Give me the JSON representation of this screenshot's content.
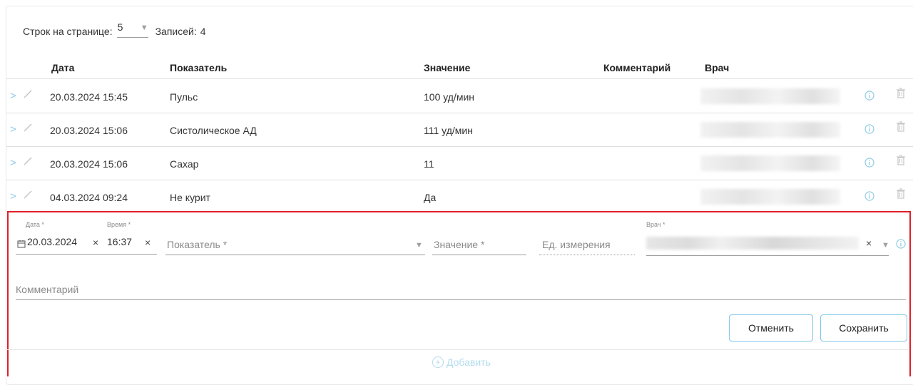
{
  "toolbar": {
    "rows_label": "Строк на странице:",
    "rows_value": "5",
    "records_label": "Записей:",
    "records_count": "4"
  },
  "table": {
    "headers": {
      "date": "Дата",
      "indicator": "Показатель",
      "value": "Значение",
      "comment": "Комментарий",
      "doctor": "Врач"
    },
    "rows": [
      {
        "date": "20.03.2024 15:45",
        "indicator": "Пульс",
        "value": "100 уд/мин",
        "comment": ""
      },
      {
        "date": "20.03.2024 15:06",
        "indicator": "Систолическое АД",
        "value": "111 уд/мин",
        "comment": ""
      },
      {
        "date": "20.03.2024 15:06",
        "indicator": "Сахар",
        "value": "11",
        "comment": ""
      },
      {
        "date": "04.03.2024 09:24",
        "indicator": "Не курит",
        "value": "Да",
        "comment": ""
      }
    ]
  },
  "editor": {
    "date_label": "Дата *",
    "date_value": "20.03.2024",
    "time_label": "Время *",
    "time_value": "16:37",
    "indicator_placeholder": "Показатель *",
    "value_placeholder": "Значение *",
    "unit_placeholder": "Ед. измерения",
    "doctor_label": "Врач *",
    "comment_placeholder": "Комментарий",
    "cancel_label": "Отменить",
    "save_label": "Сохранить",
    "clear_symbol": "×"
  },
  "add_label": "Добавить",
  "colors": {
    "accent": "#8ecbe6",
    "highlight_border": "#e0202a",
    "button_border": "#80c8e8"
  }
}
